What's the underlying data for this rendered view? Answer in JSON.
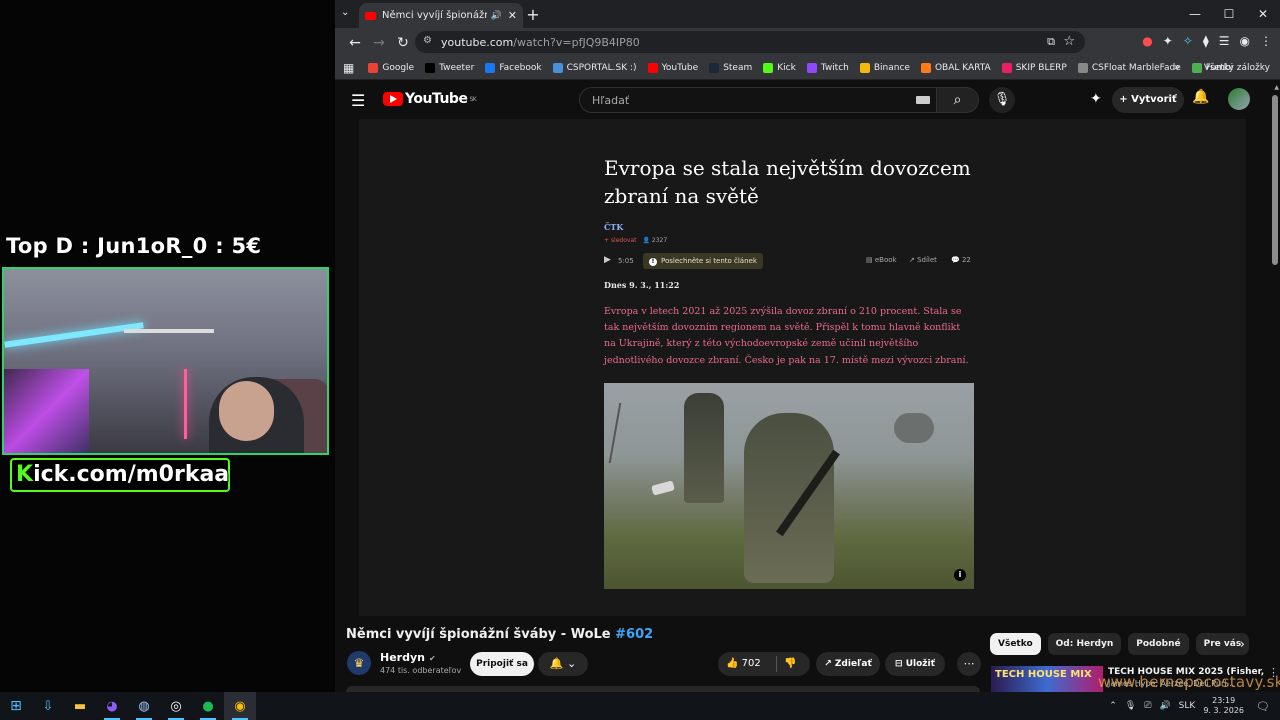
{
  "overlay": {
    "top_donor": "Top D : Jun1oR_0 : 5€",
    "kick_prefix": "K",
    "kick_rest": "ick.com/m0rkaa"
  },
  "browser": {
    "tab": {
      "title": "Němci vyvíjí špionážní švábi",
      "close": "✕"
    },
    "new_tab": "+",
    "window_controls": {
      "minimize": "—",
      "maximize": "☐",
      "close": "✕"
    },
    "url_host": "youtube.com",
    "url_path": "/watch?v=pfJQ9B4IP80",
    "bookmarks": [
      {
        "label": "Google",
        "color": "#ea4335"
      },
      {
        "label": "Tweeter",
        "color": "#000000"
      },
      {
        "label": "Facebook",
        "color": "#1877f2"
      },
      {
        "label": "CSPORTAL.SK :)",
        "color": "#4a90d9"
      },
      {
        "label": "YouTube",
        "color": "#ff0000"
      },
      {
        "label": "Steam",
        "color": "#1b2838"
      },
      {
        "label": "Kick",
        "color": "#53fc18"
      },
      {
        "label": "Twitch",
        "color": "#9146ff"
      },
      {
        "label": "Binance",
        "color": "#f0b90b"
      },
      {
        "label": "OBAL KARTA",
        "color": "#ff7a1a"
      },
      {
        "label": "SKIP BLERP",
        "color": "#e91e63"
      },
      {
        "label": "CSFloat MarbleFade",
        "color": "#888888"
      },
      {
        "label": "Fumbi",
        "color": "#4caf50"
      }
    ],
    "bookmarks_more": "»",
    "all_bookmarks": "Všetky záložky"
  },
  "youtube": {
    "logo_text": "YouTube",
    "logo_region": "SK",
    "search_placeholder": "Hľadať",
    "create_label": "Vytvoriť",
    "article": {
      "title": "Evropa se stala největším dovozcem zbraní na světě",
      "source": "ČTK",
      "follow": "+ sledovat",
      "followers": "2327",
      "duration": "5:05",
      "listen_chip": "Poslechněte si tento článek",
      "ebook": "eBook",
      "share": "Sdílet",
      "comments": "22",
      "date": "Dnes 9. 3., 11:22",
      "lead": "Evropa v letech 2021 až 2025 zvýšila dovoz zbraní o 210 procent. Stala se tak největším dovozním regionem na světě. Přispěl k tomu hlavně konflikt na Ukrajině, který z této východoevropské země učinil největšího jednotlivého dovozce zbraní. Česko je pak na 17. místě mezi vývozci zbraní.",
      "photo_info": "i"
    },
    "video": {
      "title": "Němci vyvíjí špionážní šváby - WoLe ",
      "episode_tag": "#602",
      "channel": "Herdyn",
      "subscribers": "474 tis. odberateľov",
      "join": "Pripojiť sa",
      "likes": "702",
      "share": "Zdieľať",
      "save": "Uložiť"
    },
    "chips": [
      "Všetko",
      "Od: Herdyn",
      "Podobné",
      "Pre vás"
    ],
    "recommendation": {
      "thumb_text": "TECH HOUSE MIX",
      "title": "TECH HOUSE MIX 2025 (Fisher,",
      "subtitle": "James Hype, Aerzee, Deli Puri..."
    }
  },
  "watermark": "www.hernepocostavy.sk",
  "taskbar": {
    "lang": "SLK",
    "time": "23:19",
    "date": "9. 3. 2026"
  }
}
